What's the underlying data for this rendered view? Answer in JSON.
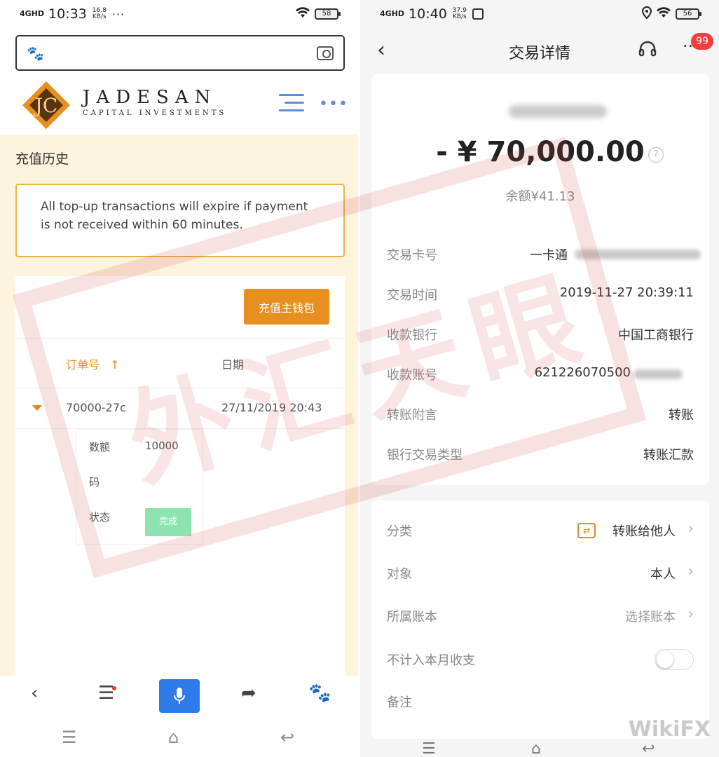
{
  "left": {
    "status": {
      "signal": "4GHD",
      "time": "10:33",
      "speed_value": "16.8",
      "speed_unit": "KB/s",
      "dots": "···",
      "battery": "58"
    },
    "browser": {
      "logo_text": "JADESAN",
      "logo_sub": "CAPITAL INVESTMENTS"
    },
    "page": {
      "title": "充值历史",
      "notice": "All top-up transactions will expire if payment is not received within 60 minutes.",
      "topup_button": "充值主钱包",
      "col_order": "订单号",
      "col_sort_arrow": "↑",
      "col_date": "日期",
      "row": {
        "order": "70000-27c",
        "date": "27/11/2019 20:43"
      },
      "detail": {
        "amount_label": "数额",
        "amount_value": "10000",
        "code_label": "码",
        "status_label": "状态",
        "status_value": "完成"
      }
    }
  },
  "right": {
    "status": {
      "signal": "4GHD",
      "time": "10:40",
      "speed_value": "37.9",
      "speed_unit": "KB/s",
      "battery": "56"
    },
    "header": {
      "title": "交易详情",
      "badge": "99"
    },
    "summary": {
      "amount": "- ¥ 70,000.00",
      "help": "?",
      "balance": "余额¥41.13"
    },
    "details": [
      {
        "key": "交易卡号",
        "value": "一卡通"
      },
      {
        "key": "交易时间",
        "value": "2019-11-27 20:39:11"
      },
      {
        "key": "收款银行",
        "value": "中国工商银行"
      },
      {
        "key": "收款账号",
        "value": "621226070500"
      },
      {
        "key": "转账附言",
        "value": "转账"
      },
      {
        "key": "银行交易类型",
        "value": "转账汇款"
      }
    ],
    "options": {
      "category_label": "分类",
      "category_value": "转账给他人",
      "target_label": "对象",
      "target_value": "本人",
      "account_label": "所属账本",
      "account_value": "选择账本",
      "exclude_label": "不计入本月收支",
      "note_label": "备注"
    }
  },
  "watermark": {
    "stamp": "外汇天眼",
    "brand": "WikiFX"
  },
  "colors": {
    "orange": "#e8901f",
    "blue": "#2d7ae8",
    "red_badge": "#f03d3d",
    "green_badge": "#8ee4b0"
  }
}
